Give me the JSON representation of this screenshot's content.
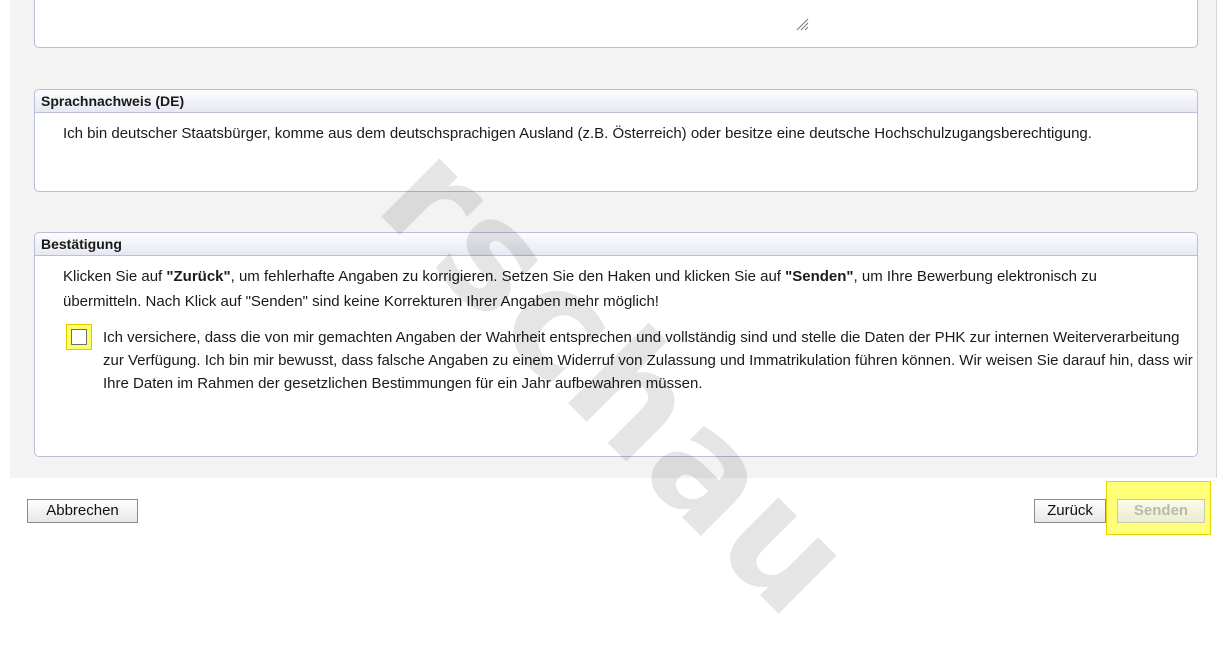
{
  "sprachnachweis": {
    "title": "Sprachnachweis (DE)",
    "text": "Ich bin deutscher Staatsbürger, komme aus dem deutschsprachigen Ausland (z.B. Österreich) oder besitze eine deutsche Hochschulzugangsberechtigung."
  },
  "bestaetigung": {
    "title": "Bestätigung",
    "intro_1": "Klicken Sie auf ",
    "intro_zurueck": "\"Zurück\"",
    "intro_2": ", um fehlerhafte Angaben zu korrigieren. Setzen Sie den Haken und klicken Sie auf ",
    "intro_senden": "\"Senden\"",
    "intro_3": ", um Ihre Bewerbung elektronisch zu übermitteln. Nach Klick auf \"Senden\" sind keine Korrekturen Ihrer Angaben mehr möglich!",
    "confirm_text": "Ich versichere, dass die von mir gemachten Angaben der Wahrheit entsprechen und vollständig sind und stelle die Daten der PHK zur internen Weiterverarbeitung zur Verfügung. Ich bin mir bewusst, dass falsche Angaben zu einem Widerruf von Zulassung und Immatrikulation führen können. Wir weisen Sie darauf hin, dass wir Ihre Daten im Rahmen der gesetzlichen Bestimmungen für ein Jahr aufbewahren müssen.",
    "confirm_checked": false
  },
  "watermark": "rschau",
  "buttons": {
    "cancel": "Abbrechen",
    "back": "Zurück",
    "send": "Senden"
  },
  "colors": {
    "highlight": "#ffff77",
    "panel_border": "#b9bfd6"
  },
  "icons": {
    "resize": "resize-grip-icon"
  }
}
